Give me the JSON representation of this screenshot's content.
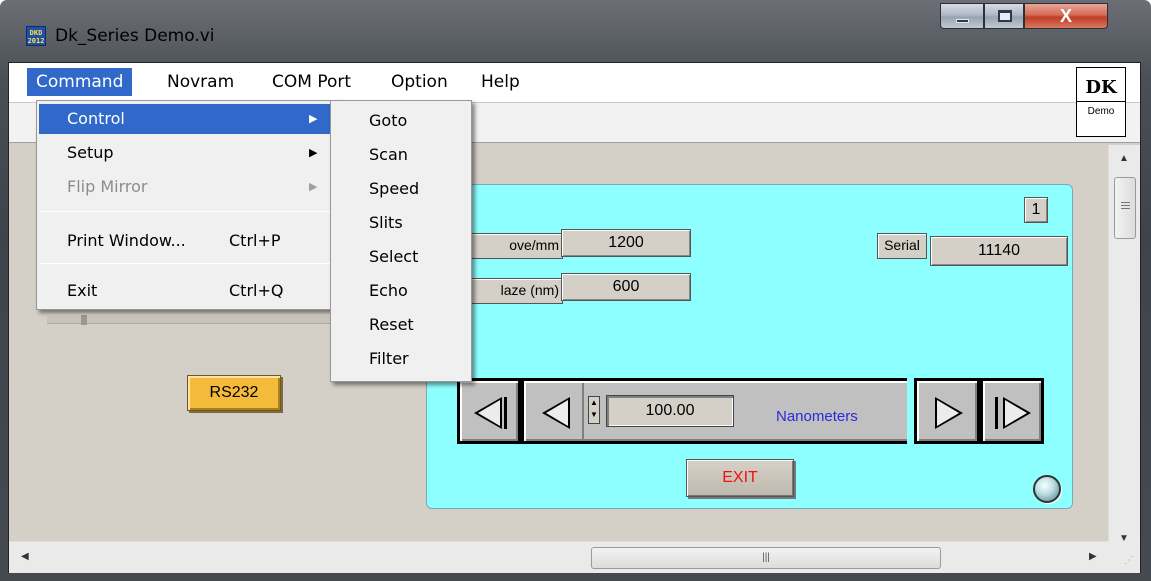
{
  "window": {
    "title": "Dk_Series Demo.vi",
    "icon_text": "DKD 2012",
    "buttons": {
      "minimize": "minimize",
      "maximize": "maximize",
      "close": "X"
    }
  },
  "menubar": {
    "items": [
      {
        "label": "Command",
        "active": true
      },
      {
        "label": "Novram"
      },
      {
        "label": "COM Port"
      },
      {
        "label": "Option"
      },
      {
        "label": "Help"
      }
    ]
  },
  "logo": {
    "big": "DK",
    "small": "Demo"
  },
  "command_menu": {
    "items": [
      {
        "label": "Control",
        "submenu": true,
        "highlighted": true
      },
      {
        "label": "Setup",
        "submenu": true
      },
      {
        "label": "Flip Mirror",
        "submenu": true,
        "disabled": true
      },
      {
        "label": "Print Window...",
        "shortcut": "Ctrl+P"
      },
      {
        "label": "Exit",
        "shortcut": "Ctrl+Q"
      }
    ]
  },
  "control_submenu": {
    "items": [
      "Goto",
      "Scan",
      "Speed",
      "Slits",
      "Select",
      "Echo",
      "Reset",
      "Filter"
    ]
  },
  "panel": {
    "index": "1",
    "groove_label": "ove/mm",
    "groove_value": "1200",
    "blaze_label": "laze (nm)",
    "blaze_value": "600",
    "serial_label": "Serial",
    "serial_value": "11140",
    "wavelength": "100.00",
    "units": "Nanometers",
    "exit_label": "EXIT",
    "rs232_label": "RS232"
  },
  "colors": {
    "panel_bg": "#8effff",
    "menu_highlight": "#3069c9",
    "rs232": "#f4ba3c",
    "exit_text": "#ef1010",
    "units_text": "#2a2add"
  }
}
